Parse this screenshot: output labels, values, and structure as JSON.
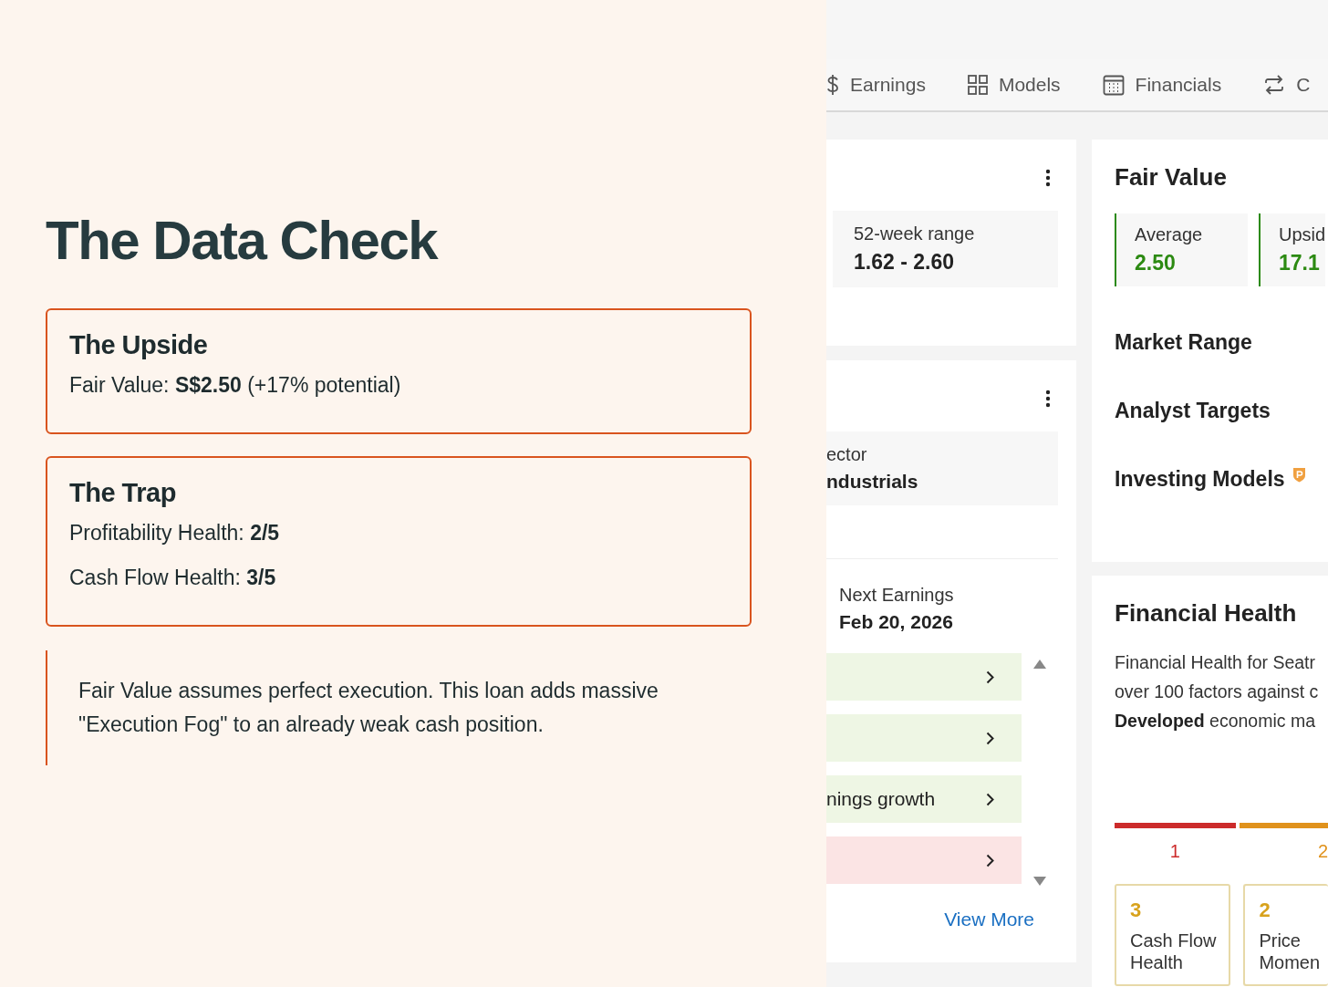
{
  "slide": {
    "title": "The Data Check",
    "cards": [
      {
        "title": "The Upside",
        "lines": [
          "Fair Value: **S$2.50** (+17% potential)"
        ]
      },
      {
        "title": "The Trap",
        "lines": [
          "Profitability Health: **2/5**",
          "Cash Flow Health: **3/5**"
        ]
      }
    ],
    "quote": "Fair Value assumes perfect execution. This loan adds massive \"Execution Fog\" to an already weak cash position."
  },
  "screenshot": {
    "tabs": [
      {
        "label": "Earnings"
      },
      {
        "label": "Models"
      },
      {
        "label": "Financials"
      },
      {
        "label": "C"
      }
    ],
    "range_card": {
      "label": "52-week range",
      "value": "1.62 - 2.60"
    },
    "info_card": {
      "sector_label": "ector",
      "sector_value": "ndustrials",
      "next_label": "Next Earnings",
      "next_value": "Feb 20, 2026",
      "rows": [
        {
          "kind": "positive"
        },
        {
          "kind": "positive"
        },
        {
          "kind": "positive",
          "label": "nings growth"
        },
        {
          "kind": "negative"
        }
      ],
      "link": "View More"
    },
    "fair_value": {
      "title": "Fair Value",
      "stats": [
        {
          "label": "Average",
          "value": "2.50"
        },
        {
          "label": "Upsid",
          "value": "17.1"
        }
      ],
      "sections": [
        "Market Range",
        "Analyst Targets",
        "Investing Models"
      ]
    },
    "health": {
      "title": "Financial Health",
      "text_lines": [
        "Financial Health for Seatr",
        "over 100 factors against c",
        "**Developed** economic ma"
      ],
      "segments": [
        {
          "label": "1",
          "color": "#cc2b2b"
        },
        {
          "label": "2",
          "color": "#e0921c"
        }
      ],
      "scores": [
        {
          "score": "3",
          "label": "Cash Flow Health"
        },
        {
          "score": "2",
          "label": "Price Momen"
        }
      ]
    }
  }
}
